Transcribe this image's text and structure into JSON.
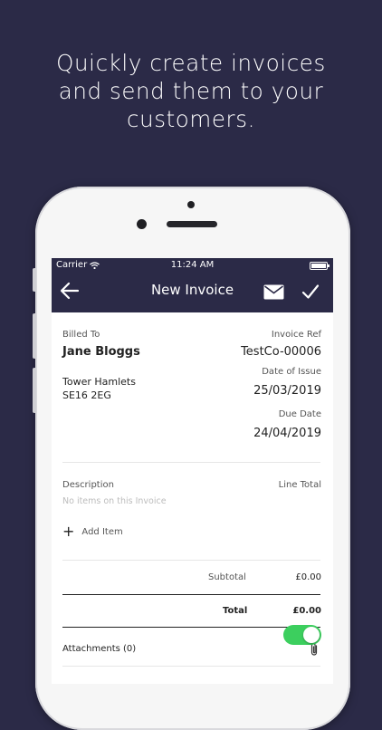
{
  "headline": {
    "line1": "Quickly create invoices",
    "line2": "and send them to your",
    "line3": "customers."
  },
  "status_bar": {
    "carrier": "Carrier",
    "time": "11:24 AM"
  },
  "nav": {
    "title": "New Invoice",
    "back_icon": "arrow-left-icon",
    "mail_icon": "envelope-icon",
    "save_icon": "checkmark-icon"
  },
  "invoice": {
    "billed_to_label": "Billed To",
    "customer_name": "Jane Bloggs",
    "address_line1": "Tower Hamlets",
    "address_line2": "SE16 2EG",
    "invoice_ref_label": "Invoice Ref",
    "invoice_ref": "TestCo-00006",
    "date_of_issue_label": "Date of Issue",
    "date_of_issue": "25/03/2019",
    "due_date_label": "Due Date",
    "due_date": "24/04/2019"
  },
  "items": {
    "description_header": "Description",
    "line_total_header": "Line Total",
    "empty_text": "No items on this Invoice",
    "add_item_label": "Add Item"
  },
  "totals": {
    "subtotal_label": "Subtotal",
    "subtotal_value": "£0.00",
    "total_label": "Total",
    "total_value": "£0.00"
  },
  "attachments": {
    "label": "Attachments (0)",
    "icon": "paperclip-icon"
  },
  "colors": {
    "background": "#2b2a47",
    "toggle_on": "#3ccf5e"
  }
}
